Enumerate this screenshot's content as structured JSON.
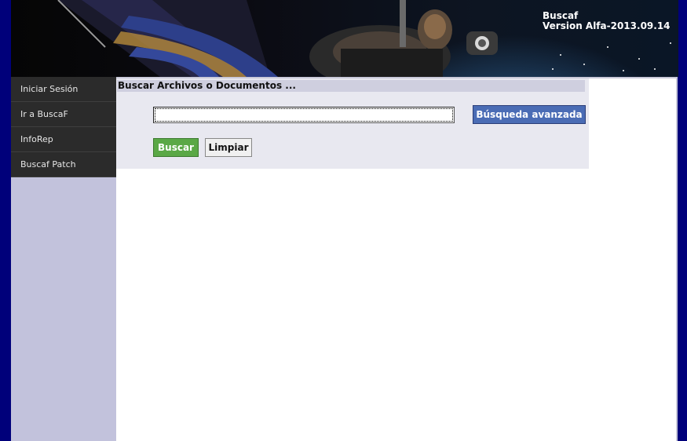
{
  "header": {
    "title_line1": "Buscaf",
    "title_line2": "Version Alfa-2013.09.14"
  },
  "sidebar": {
    "items": [
      {
        "label": "Iniciar Sesión"
      },
      {
        "label": "Ir a BuscaF"
      },
      {
        "label": "InfoRep"
      },
      {
        "label": "Buscaf Patch"
      }
    ]
  },
  "search": {
    "title": "Buscar Archivos o Documentos ...",
    "input_value": "",
    "advanced_label": "Búsqueda avanzada",
    "search_label": "Buscar",
    "clear_label": "Limpiar"
  },
  "colors": {
    "page_background": "#00007a",
    "sidebar_nav": "#2b2b2b",
    "sidebar_fill": "#c2c2dc",
    "search_panel": "#e8e8f0",
    "advanced_button": "#4a6cb5",
    "search_button": "#5aa846"
  }
}
